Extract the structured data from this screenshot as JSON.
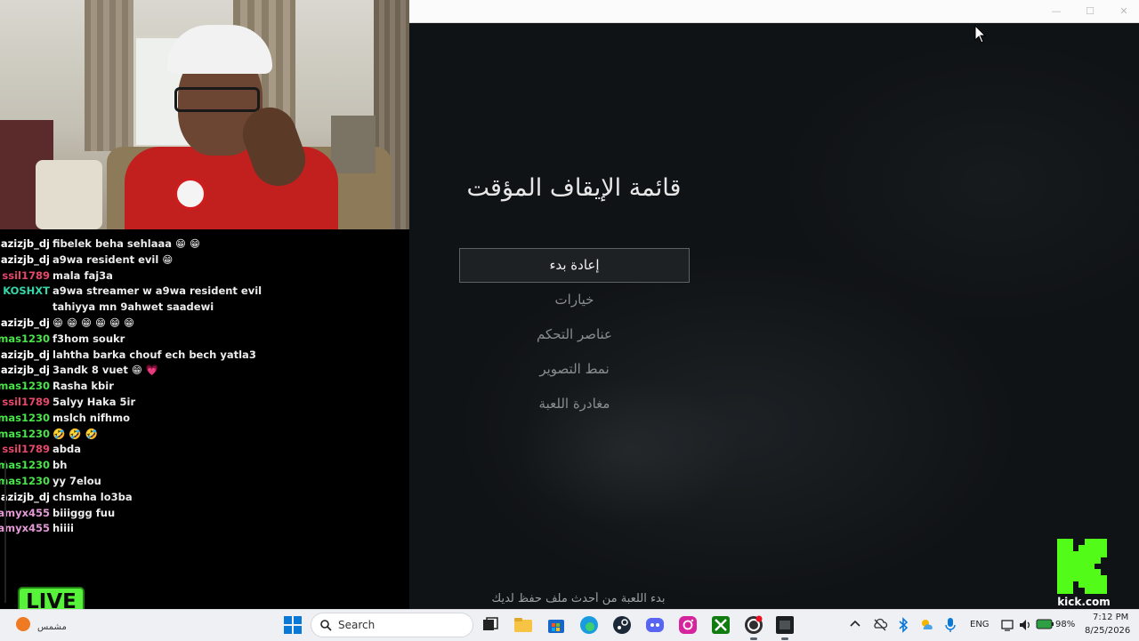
{
  "game_window": {
    "minimize": "—",
    "maximize": "☐",
    "close": "✕"
  },
  "pause_menu": {
    "title": "قائمة الإيقاف المؤقت",
    "items": [
      {
        "label": "إعادة بدء",
        "selected": true
      },
      {
        "label": "خيارات"
      },
      {
        "label": "عناصر التحكم"
      },
      {
        "label": "نمط التصوير"
      },
      {
        "label": "مغادرة اللعبة"
      }
    ],
    "footer": "بدء اللعبة من أحدث ملف حفظ لديك"
  },
  "chat": {
    "messages": [
      {
        "user": "azizjb_dj",
        "color": "#ffffff",
        "text": "fibelek beha sehlaaa 😁 😁"
      },
      {
        "user": "azizjb_dj",
        "color": "#ffffff",
        "text": "a9wa resident evil 😁"
      },
      {
        "user": "ssil1789",
        "color": "#e8466a",
        "text": "mala faj3a"
      },
      {
        "user": "KOSHXT",
        "color": "#35d6a8",
        "text": "a9wa streamer w a9wa resident evil tahiyya mn 9ahwet saadewi"
      },
      {
        "user": "azizjb_dj",
        "color": "#ffffff",
        "text": "😁 😁 😁 😁 😁 😁"
      },
      {
        "user": "mas1230",
        "color": "#47e548",
        "text": "f3hom soukr"
      },
      {
        "user": "azizjb_dj",
        "color": "#ffffff",
        "text": "lahtha barka chouf ech bech yatla3"
      },
      {
        "user": "azizjb_dj",
        "color": "#ffffff",
        "text": "3andk 8 vuet 😁 💗"
      },
      {
        "user": "mas1230",
        "color": "#47e548",
        "text": "Rasha kbir"
      },
      {
        "user": "ssil1789",
        "color": "#e8466a",
        "text": "5alyy Haka 5ir"
      },
      {
        "user": "mas1230",
        "color": "#47e548",
        "text": "mslch nifhmo"
      },
      {
        "user": "mas1230",
        "color": "#47e548",
        "text": "🤣 🤣 🤣"
      },
      {
        "user": "ssil1789",
        "color": "#e8466a",
        "text": "abda"
      },
      {
        "user": "mas1230",
        "color": "#47e548",
        "text": "bh"
      },
      {
        "user": "mas1230",
        "color": "#47e548",
        "text": "yy 7elou"
      },
      {
        "user": "azizjb_dj",
        "color": "#ffffff",
        "text": "chsmha lo3ba"
      },
      {
        "user": "amyx455",
        "color": "#e59ad6",
        "text": "biiiggg fuu"
      },
      {
        "user": "amyx455",
        "color": "#e59ad6",
        "text": "hiiii"
      }
    ]
  },
  "stream": {
    "live_label": "LIVE",
    "kick_domain": "kick.com"
  },
  "taskbar": {
    "weather_text": "مشمس",
    "search_label": "Search",
    "language": "ENG",
    "battery": "98%",
    "time": "7:12 PM",
    "date": "8/25/2026",
    "icons": [
      "windows-start-icon",
      "task-view-icon",
      "file-explorer-icon",
      "store-icon",
      "edge-icon",
      "steam-icon",
      "discord-icon",
      "instagram-icon",
      "xbox-icon",
      "obs-icon",
      "game-icon"
    ]
  }
}
